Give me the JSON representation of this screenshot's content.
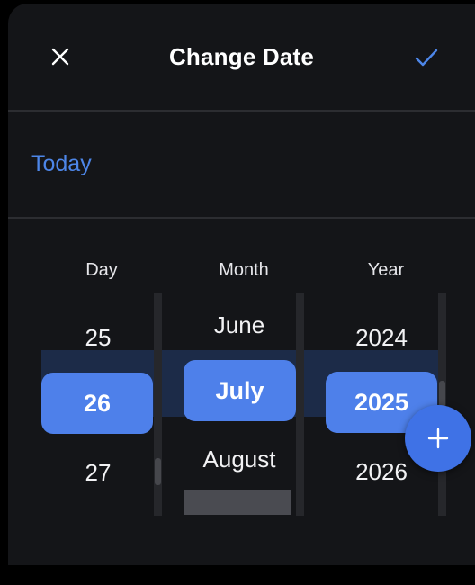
{
  "dialog": {
    "title": "Change Date",
    "close_icon": "close-icon",
    "confirm_icon": "checkmark-icon",
    "today_label": "Today"
  },
  "picker": {
    "columns": [
      {
        "header": "Day",
        "above": "25",
        "selected": "26",
        "below": "27"
      },
      {
        "header": "Month",
        "above": "June",
        "selected": "July",
        "below": "August"
      },
      {
        "header": "Year",
        "above": "2024",
        "selected": "2025",
        "below": "2026"
      }
    ]
  },
  "fab": {
    "icon": "plus-icon"
  },
  "colors": {
    "accent": "#4e80ea",
    "link": "#4d86e8",
    "background": "#141518"
  }
}
